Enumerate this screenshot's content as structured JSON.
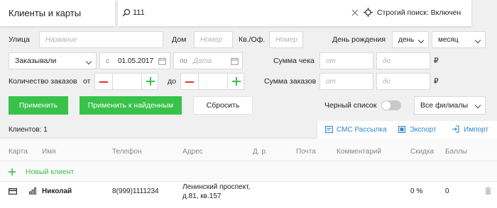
{
  "header": {
    "title": "Клиенты и карты",
    "search_value": "111",
    "strict_search": "Строгий поиск: Включен"
  },
  "filters": {
    "street_label": "Улица",
    "street_placeholder": "Название",
    "house_label": "Дом",
    "house_placeholder": "Номер",
    "apt_label": "Кв./Оф.",
    "apt_placeholder": "Номер",
    "birthday_label": "День рождения",
    "birthday_day": "день",
    "birthday_month": "месяц",
    "order_mode": "Заказывали",
    "date_from_prefix": "с",
    "date_from": "01.05.2017",
    "date_to_prefix": "по",
    "date_to_placeholder": "Дата",
    "receipt_label": "Сумма чека",
    "orders_sum_label": "Сумма заказов",
    "from_placeholder": "от",
    "to_placeholder": "до",
    "currency": "₽",
    "order_count_label": "Количество заказов",
    "from_label": "от",
    "to_label": "до",
    "blacklist_label": "Черный список",
    "branches": "Все филиалы"
  },
  "buttons": {
    "apply": "Применить",
    "apply_found": "Применить к найденным",
    "reset": "Сбросить"
  },
  "toolbar": {
    "count": "Клиентов: 1",
    "sms": "СМС Рассылка",
    "export": "Экспорт",
    "import": "Импорт"
  },
  "table": {
    "columns": [
      "Карта",
      "Имя",
      "Телефон",
      "Адрес",
      "Д. р.",
      "Почта",
      "Комментарий",
      "Скидка",
      "Баллы"
    ],
    "new_client": "Новый клиент",
    "rows": [
      {
        "name": "Николай",
        "phone": "8(999)1111234",
        "address_line1": "Ленинский проспект,",
        "address_line2": "д.81, кв.157",
        "discount": "0 %",
        "points": "0"
      }
    ]
  },
  "colors": {
    "accent_green": "#38c24a",
    "minus_red": "#e8312f",
    "link_blue": "#2f86d1"
  }
}
